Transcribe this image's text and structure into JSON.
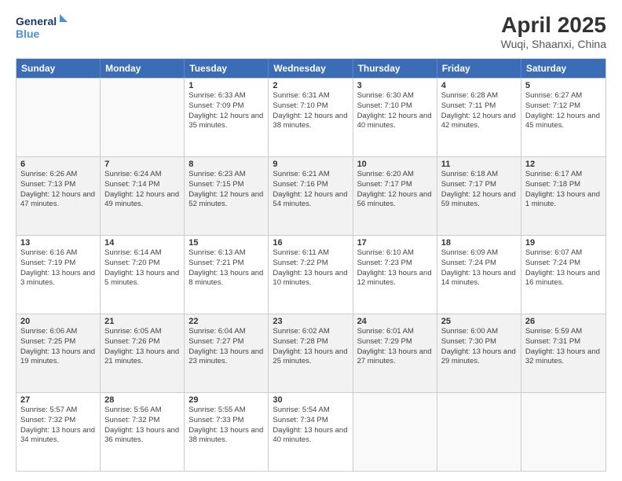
{
  "logo": {
    "line1": "General",
    "line2": "Blue"
  },
  "title": "April 2025",
  "subtitle": "Wuqi, Shaanxi, China",
  "header_days": [
    "Sunday",
    "Monday",
    "Tuesday",
    "Wednesday",
    "Thursday",
    "Friday",
    "Saturday"
  ],
  "rows": [
    [
      {
        "day": "",
        "info": ""
      },
      {
        "day": "",
        "info": ""
      },
      {
        "day": "1",
        "info": "Sunrise: 6:33 AM\nSunset: 7:09 PM\nDaylight: 12 hours and 35 minutes."
      },
      {
        "day": "2",
        "info": "Sunrise: 6:31 AM\nSunset: 7:10 PM\nDaylight: 12 hours and 38 minutes."
      },
      {
        "day": "3",
        "info": "Sunrise: 6:30 AM\nSunset: 7:10 PM\nDaylight: 12 hours and 40 minutes."
      },
      {
        "day": "4",
        "info": "Sunrise: 6:28 AM\nSunset: 7:11 PM\nDaylight: 12 hours and 42 minutes."
      },
      {
        "day": "5",
        "info": "Sunrise: 6:27 AM\nSunset: 7:12 PM\nDaylight: 12 hours and 45 minutes."
      }
    ],
    [
      {
        "day": "6",
        "info": "Sunrise: 6:26 AM\nSunset: 7:13 PM\nDaylight: 12 hours and 47 minutes."
      },
      {
        "day": "7",
        "info": "Sunrise: 6:24 AM\nSunset: 7:14 PM\nDaylight: 12 hours and 49 minutes."
      },
      {
        "day": "8",
        "info": "Sunrise: 6:23 AM\nSunset: 7:15 PM\nDaylight: 12 hours and 52 minutes."
      },
      {
        "day": "9",
        "info": "Sunrise: 6:21 AM\nSunset: 7:16 PM\nDaylight: 12 hours and 54 minutes."
      },
      {
        "day": "10",
        "info": "Sunrise: 6:20 AM\nSunset: 7:17 PM\nDaylight: 12 hours and 56 minutes."
      },
      {
        "day": "11",
        "info": "Sunrise: 6:18 AM\nSunset: 7:17 PM\nDaylight: 12 hours and 59 minutes."
      },
      {
        "day": "12",
        "info": "Sunrise: 6:17 AM\nSunset: 7:18 PM\nDaylight: 13 hours and 1 minute."
      }
    ],
    [
      {
        "day": "13",
        "info": "Sunrise: 6:16 AM\nSunset: 7:19 PM\nDaylight: 13 hours and 3 minutes."
      },
      {
        "day": "14",
        "info": "Sunrise: 6:14 AM\nSunset: 7:20 PM\nDaylight: 13 hours and 5 minutes."
      },
      {
        "day": "15",
        "info": "Sunrise: 6:13 AM\nSunset: 7:21 PM\nDaylight: 13 hours and 8 minutes."
      },
      {
        "day": "16",
        "info": "Sunrise: 6:11 AM\nSunset: 7:22 PM\nDaylight: 13 hours and 10 minutes."
      },
      {
        "day": "17",
        "info": "Sunrise: 6:10 AM\nSunset: 7:23 PM\nDaylight: 13 hours and 12 minutes."
      },
      {
        "day": "18",
        "info": "Sunrise: 6:09 AM\nSunset: 7:24 PM\nDaylight: 13 hours and 14 minutes."
      },
      {
        "day": "19",
        "info": "Sunrise: 6:07 AM\nSunset: 7:24 PM\nDaylight: 13 hours and 16 minutes."
      }
    ],
    [
      {
        "day": "20",
        "info": "Sunrise: 6:06 AM\nSunset: 7:25 PM\nDaylight: 13 hours and 19 minutes."
      },
      {
        "day": "21",
        "info": "Sunrise: 6:05 AM\nSunset: 7:26 PM\nDaylight: 13 hours and 21 minutes."
      },
      {
        "day": "22",
        "info": "Sunrise: 6:04 AM\nSunset: 7:27 PM\nDaylight: 13 hours and 23 minutes."
      },
      {
        "day": "23",
        "info": "Sunrise: 6:02 AM\nSunset: 7:28 PM\nDaylight: 13 hours and 25 minutes."
      },
      {
        "day": "24",
        "info": "Sunrise: 6:01 AM\nSunset: 7:29 PM\nDaylight: 13 hours and 27 minutes."
      },
      {
        "day": "25",
        "info": "Sunrise: 6:00 AM\nSunset: 7:30 PM\nDaylight: 13 hours and 29 minutes."
      },
      {
        "day": "26",
        "info": "Sunrise: 5:59 AM\nSunset: 7:31 PM\nDaylight: 13 hours and 32 minutes."
      }
    ],
    [
      {
        "day": "27",
        "info": "Sunrise: 5:57 AM\nSunset: 7:32 PM\nDaylight: 13 hours and 34 minutes."
      },
      {
        "day": "28",
        "info": "Sunrise: 5:56 AM\nSunset: 7:32 PM\nDaylight: 13 hours and 36 minutes."
      },
      {
        "day": "29",
        "info": "Sunrise: 5:55 AM\nSunset: 7:33 PM\nDaylight: 13 hours and 38 minutes."
      },
      {
        "day": "30",
        "info": "Sunrise: 5:54 AM\nSunset: 7:34 PM\nDaylight: 13 hours and 40 minutes."
      },
      {
        "day": "",
        "info": ""
      },
      {
        "day": "",
        "info": ""
      },
      {
        "day": "",
        "info": ""
      }
    ]
  ],
  "row_alts": [
    false,
    true,
    false,
    true,
    false
  ]
}
